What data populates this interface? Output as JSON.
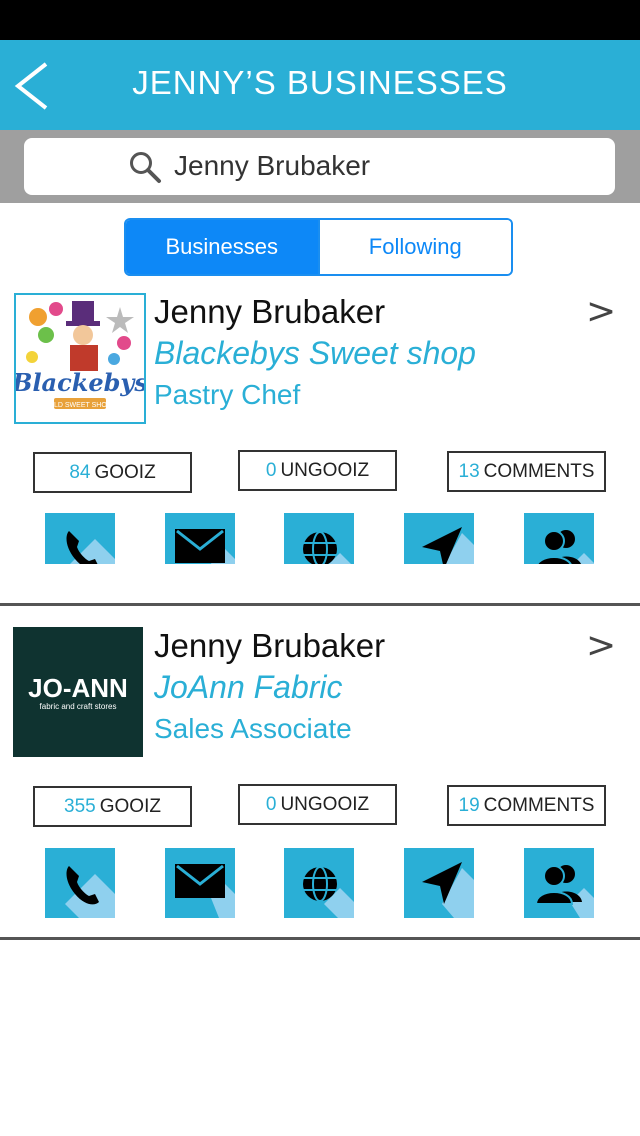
{
  "header": {
    "title": "JENNY’S BUSINESSES"
  },
  "search": {
    "value": "Jenny Brubaker"
  },
  "tabs": [
    {
      "label": "Businesses",
      "active": true
    },
    {
      "label": "Following",
      "active": false
    }
  ],
  "cards": [
    {
      "name": "Jenny Brubaker",
      "business": "Blackebys Sweet shop",
      "role": "Pastry Chef",
      "logo": {
        "brand": "Blackebys",
        "tagline": "OLD SWEET SHOP"
      },
      "stats": {
        "gooiz": {
          "value": "84",
          "label": "GOOIZ"
        },
        "ungooiz": {
          "value": "0",
          "label": "UNGOOIZ"
        },
        "comments": {
          "value": "13",
          "label": "COMMENTS"
        }
      }
    },
    {
      "name": "Jenny Brubaker",
      "business": "JoAnn Fabric",
      "role": "Sales Associate",
      "logo": {
        "brand": "JO-ANN",
        "tagline": "fabric and craft stores"
      },
      "stats": {
        "gooiz": {
          "value": "355",
          "label": "GOOIZ"
        },
        "ungooiz": {
          "value": "0",
          "label": "UNGOOIZ"
        },
        "comments": {
          "value": "19",
          "label": "COMMENTS"
        }
      }
    }
  ],
  "chevron": ">",
  "actions": [
    "phone-icon",
    "mail-icon",
    "globe-icon",
    "navigate-icon",
    "people-icon"
  ],
  "colors": {
    "accent": "#2aafd6",
    "segment_blue": "#0d88f7",
    "joann_bg": "#0f3330"
  }
}
